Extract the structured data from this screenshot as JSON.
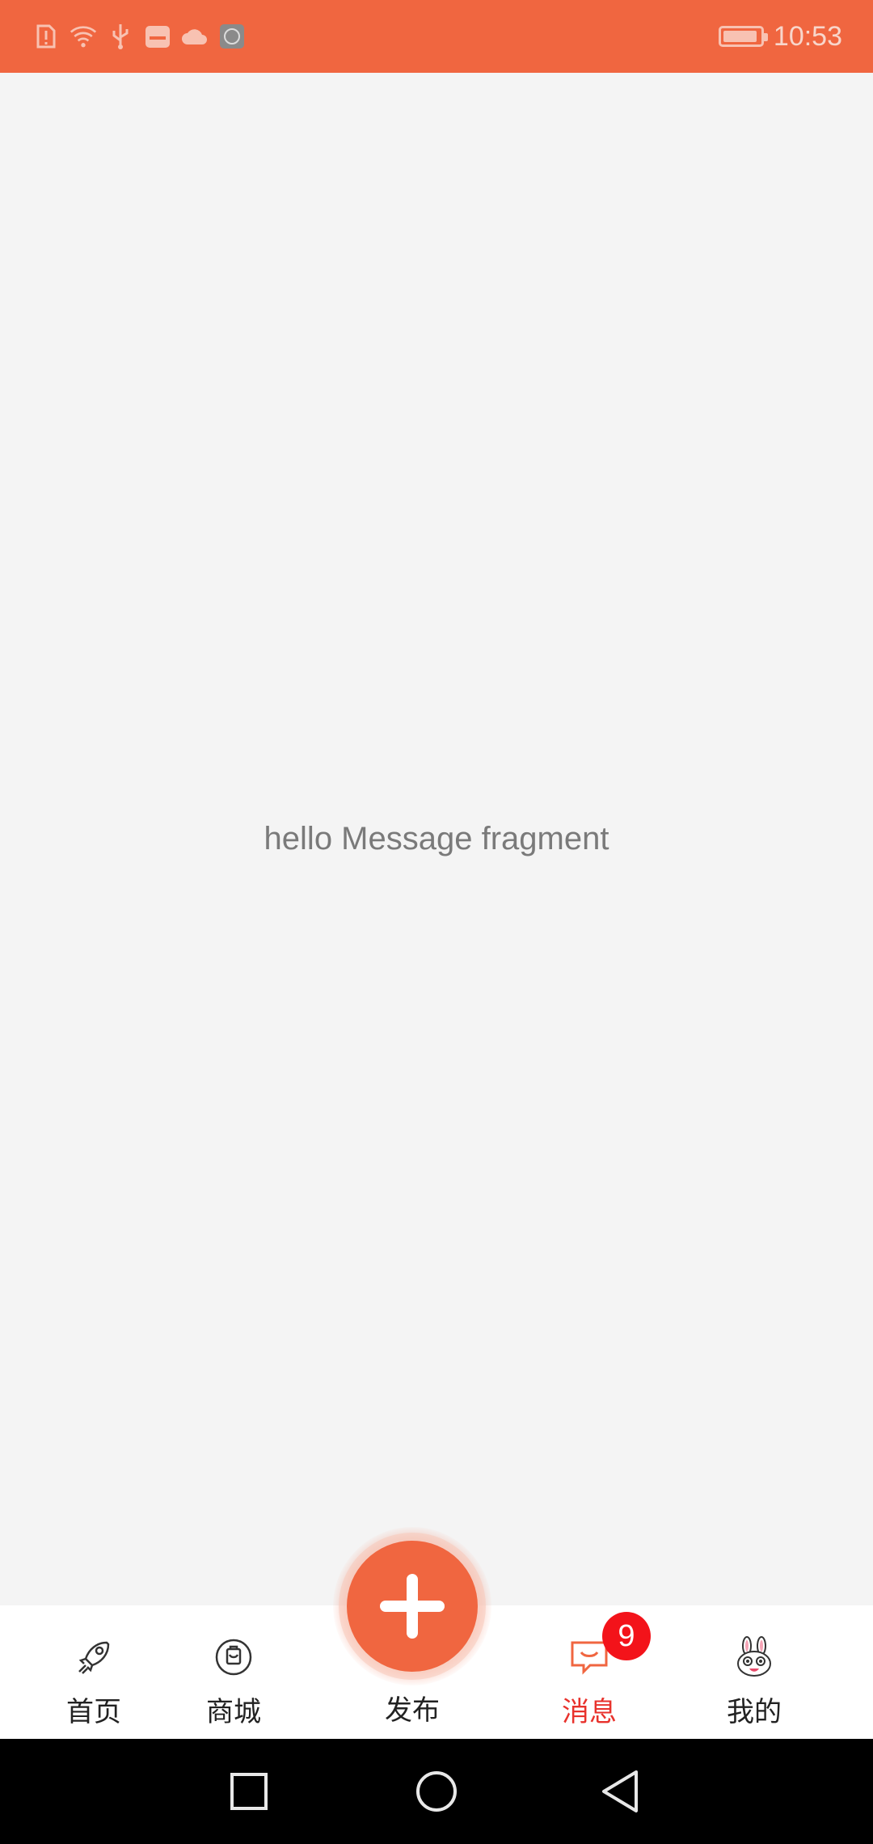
{
  "status_bar": {
    "time": "10:53",
    "icons": [
      "sim-alert-icon",
      "wifi-icon",
      "usb-icon",
      "app-notification-icon",
      "cloud-icon",
      "app-icon"
    ]
  },
  "main": {
    "message": "hello Message fragment"
  },
  "bottom_nav": {
    "items": [
      {
        "label": "首页",
        "icon": "rocket-icon"
      },
      {
        "label": "商城",
        "icon": "shopping-bag-icon"
      },
      {
        "label": "发布",
        "icon": "plus-icon"
      },
      {
        "label": "消息",
        "icon": "chat-icon",
        "active": true,
        "badge": "9"
      },
      {
        "label": "我的",
        "icon": "rabbit-avatar-icon"
      }
    ]
  },
  "colors": {
    "accent": "#f06640",
    "active_label": "#e8322c",
    "badge": "#f3131a"
  }
}
